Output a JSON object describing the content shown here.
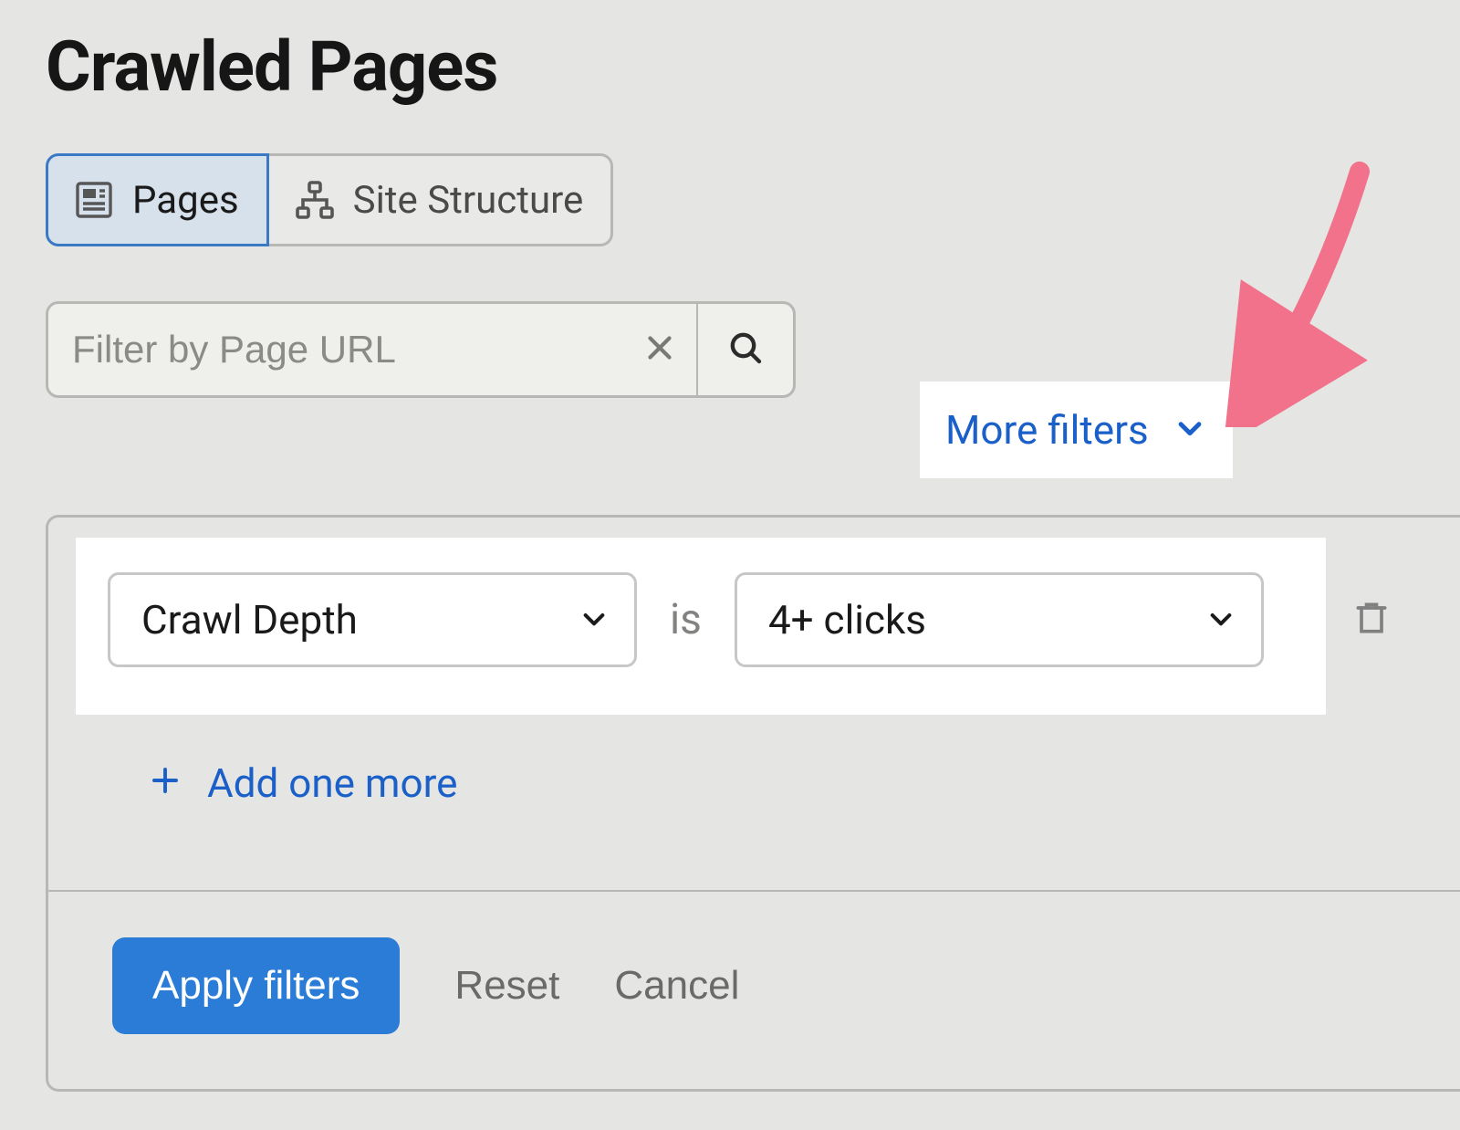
{
  "title": "Crawled Pages",
  "tabs": {
    "pages": "Pages",
    "site_structure": "Site Structure"
  },
  "search": {
    "placeholder": "Filter by Page URL"
  },
  "more_filters_label": "More filters",
  "filter_rule": {
    "field": "Crawl Depth",
    "operator": "is",
    "value": "4+ clicks"
  },
  "add_one_more": "Add one more",
  "actions": {
    "apply": "Apply filters",
    "reset": "Reset",
    "cancel": "Cancel"
  },
  "colors": {
    "accent_blue": "#1a60c8",
    "primary_blue": "#2a7cd6",
    "annotation_pink": "#f1728a"
  },
  "icons": {
    "pages": "pages-icon",
    "site_structure": "sitemap-icon",
    "clear": "close-icon",
    "search": "search-icon",
    "chevron_down": "chevron-down-icon",
    "plus": "plus-icon",
    "trash": "trash-icon"
  }
}
